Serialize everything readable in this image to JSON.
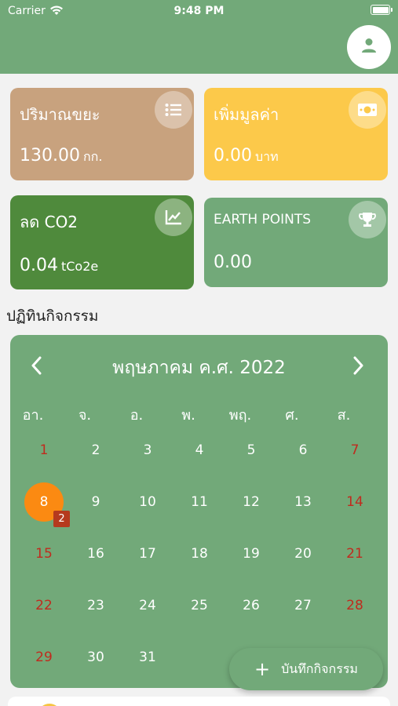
{
  "status": {
    "carrier": "Carrier",
    "time": "9:48 PM"
  },
  "header": {
    "avatar_icon": "person-icon"
  },
  "cards": {
    "waste": {
      "title": "ปริมาณขยะ",
      "value": "130.00",
      "unit": "กก.",
      "icon": "list-icon",
      "color": "#c8a27e"
    },
    "added_value": {
      "title": "เพิ่มมูลค่า",
      "value": "0.00",
      "unit": "บาท",
      "icon": "money-icon",
      "color": "#fcc94a"
    },
    "co2": {
      "title": "ลด CO2",
      "value": "0.04",
      "unit": "tCo2e",
      "icon": "trend-chart-icon",
      "color": "#4f8a3c"
    },
    "earth": {
      "title": "EARTH POINTS",
      "value": "0.00",
      "icon": "trophy-icon",
      "color": "#72a979"
    }
  },
  "section_title": "ปฏิทินกิจกรรม",
  "calendar": {
    "month_label": "พฤษภาคม ค.ศ. 2022",
    "weekdays": [
      "อา.",
      "จ.",
      "อ.",
      "พ.",
      "พฤ.",
      "ศ.",
      "ส."
    ],
    "weeks": [
      [
        "1",
        "2",
        "3",
        "4",
        "5",
        "6",
        "7"
      ],
      [
        "8",
        "9",
        "10",
        "11",
        "12",
        "13",
        "14"
      ],
      [
        "15",
        "16",
        "17",
        "18",
        "19",
        "20",
        "21"
      ],
      [
        "22",
        "23",
        "24",
        "25",
        "26",
        "27",
        "28"
      ],
      [
        "29",
        "30",
        "31"
      ]
    ],
    "today": "8",
    "today_badge": "2",
    "weekend_color": "#c02b1e",
    "today_color": "#fb8a12"
  },
  "fab": {
    "label": "บันทึกกิจกรรม",
    "icon": "plus-icon"
  }
}
